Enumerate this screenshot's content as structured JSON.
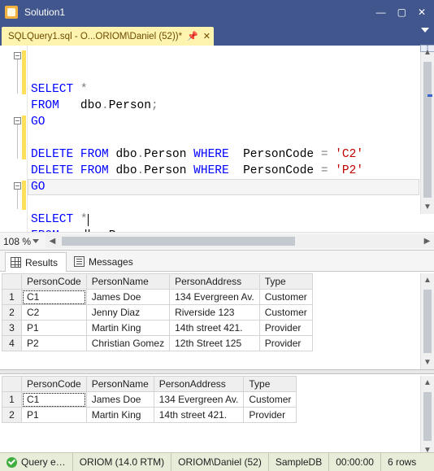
{
  "window": {
    "title": "Solution1"
  },
  "tab": {
    "label": "SQLQuery1.sql - O...ORIOM\\Daniel (52))*"
  },
  "code": {
    "kw_select": "SELECT",
    "kw_from": "FROM",
    "kw_go": "GO",
    "kw_delete": "DELETE",
    "kw_where": "WHERE",
    "star": "*",
    "eq": "=",
    "semicolon": ";",
    "tbl": "dbo",
    "dot": ".",
    "obj": "Person",
    "lit_c2": "'C2'",
    "lit_p2": "'P2'",
    "col": "PersonCode"
  },
  "zoom": {
    "value": "108 %"
  },
  "resultsTabs": {
    "results": "Results",
    "messages": "Messages"
  },
  "grid1": {
    "headers": {
      "c1": "PersonCode",
      "c2": "PersonName",
      "c3": "PersonAddress",
      "c4": "Type"
    },
    "rows": [
      {
        "n": "1",
        "c1": "C1",
        "c2": "James Doe",
        "c3": "134 Evergreen Av.",
        "c4": "Customer"
      },
      {
        "n": "2",
        "c1": "C2",
        "c2": "Jenny Diaz",
        "c3": "Riverside 123",
        "c4": "Customer"
      },
      {
        "n": "3",
        "c1": "P1",
        "c2": "Martin King",
        "c3": "14th street 421.",
        "c4": "Provider"
      },
      {
        "n": "4",
        "c1": "P2",
        "c2": "Christian Gomez",
        "c3": "12th Street 125",
        "c4": "Provider"
      }
    ]
  },
  "grid2": {
    "headers": {
      "c1": "PersonCode",
      "c2": "PersonName",
      "c3": "PersonAddress",
      "c4": "Type"
    },
    "rows": [
      {
        "n": "1",
        "c1": "C1",
        "c2": "James Doe",
        "c3": "134 Evergreen Av.",
        "c4": "Customer"
      },
      {
        "n": "2",
        "c1": "P1",
        "c2": "Martin King",
        "c3": "14th street 421.",
        "c4": "Provider"
      }
    ]
  },
  "status": {
    "query": "Query e…",
    "server": "ORIOM (14.0 RTM)",
    "login": "ORIOM\\Daniel (52)",
    "db": "SampleDB",
    "time": "00:00:00",
    "rows": "6 rows"
  }
}
